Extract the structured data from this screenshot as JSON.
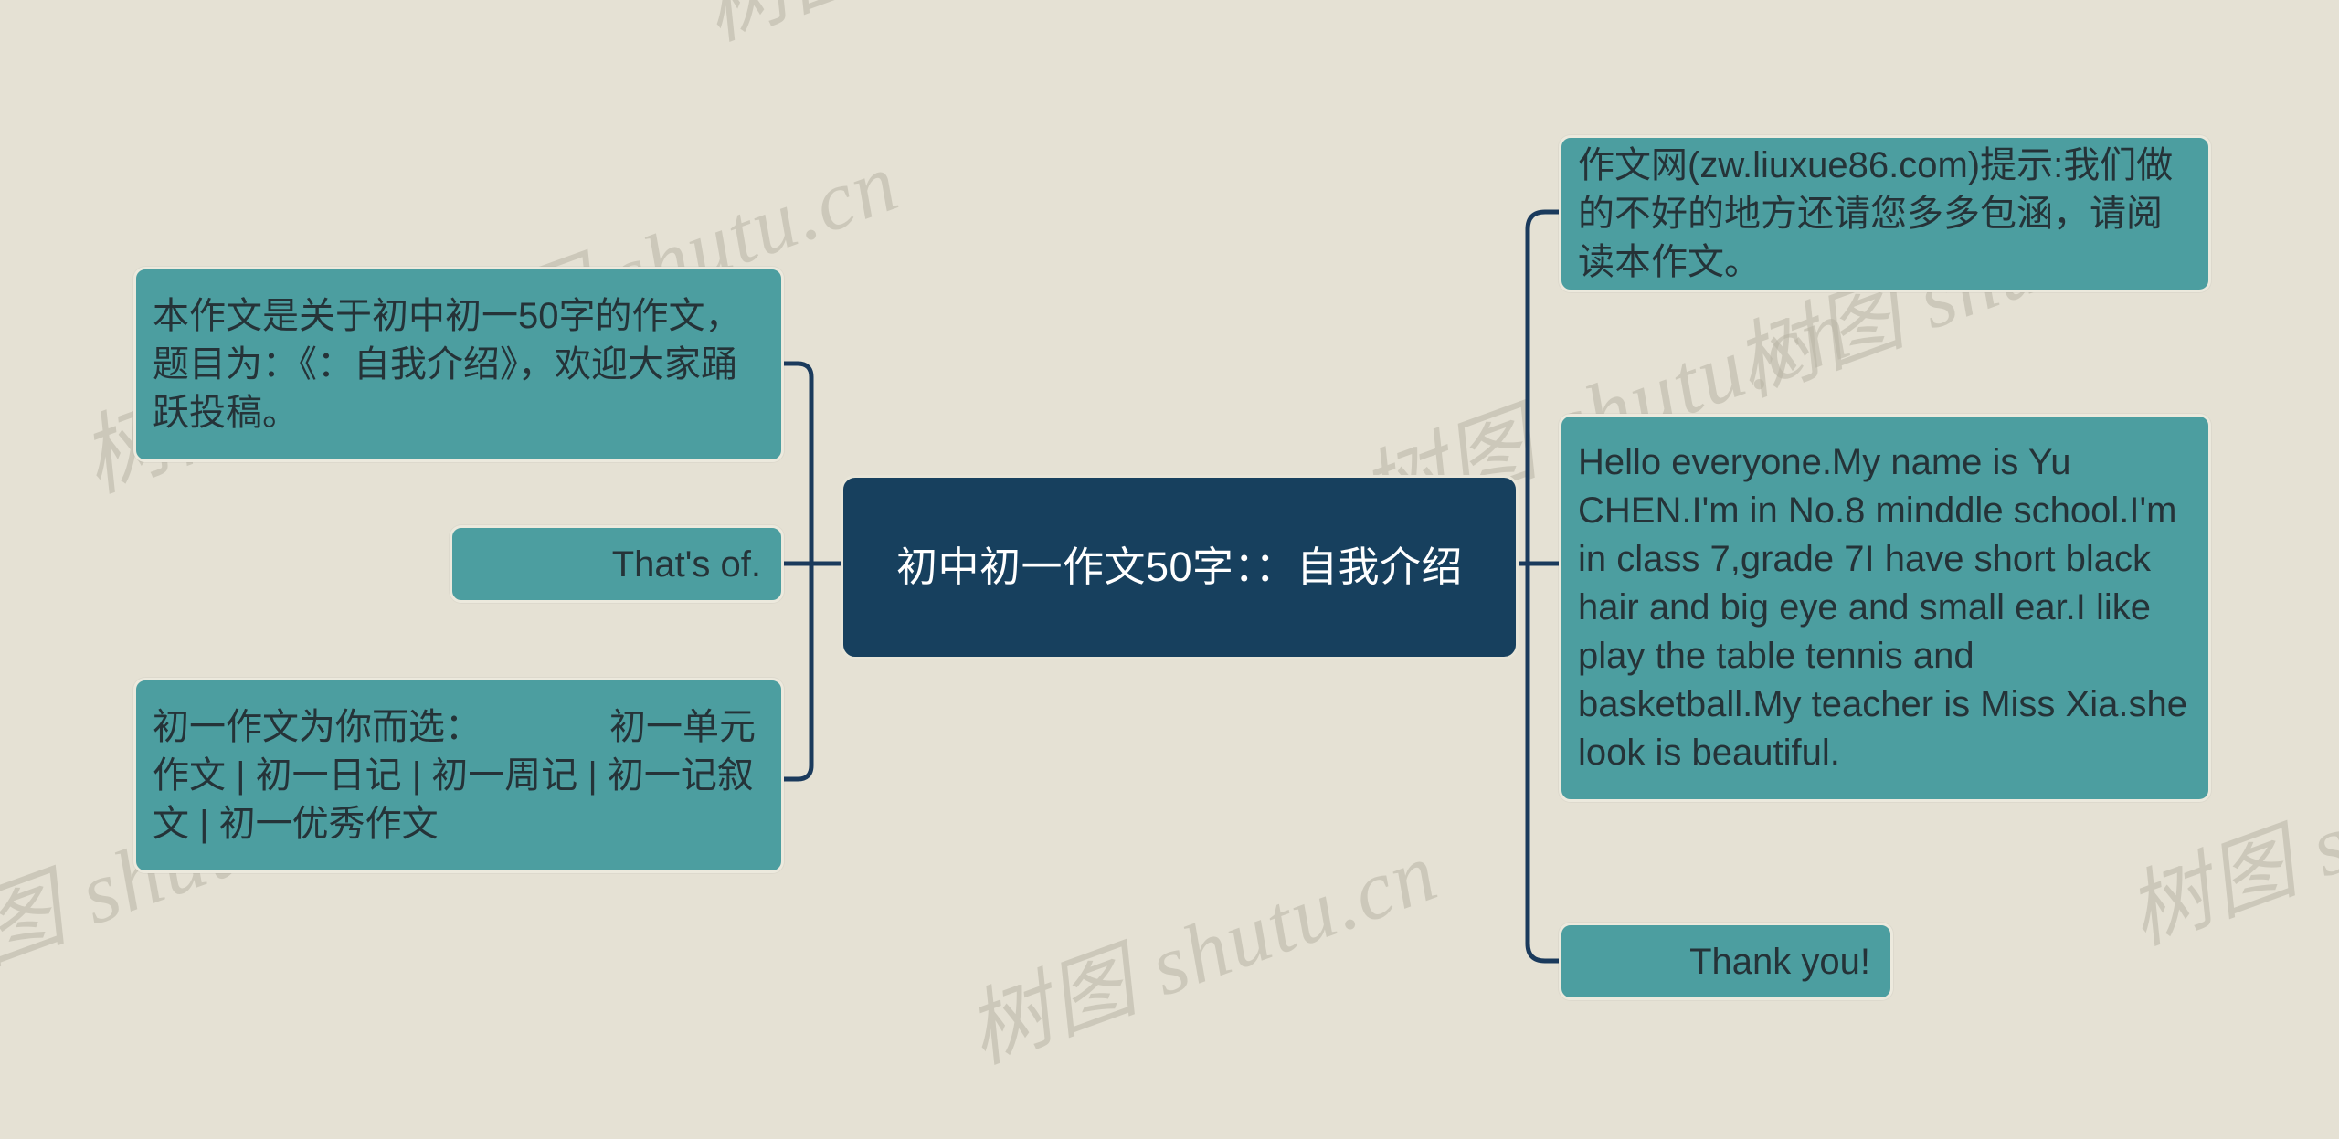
{
  "canvas": {
    "background_color": "#e5e1d4",
    "node_color": "#4c9ea0",
    "root_color": "#17405e",
    "connector_color": "#1a3a5c",
    "node_text_color": "#253338",
    "root_text_color": "#ffffff"
  },
  "watermark": {
    "text": "树图 shutu.cn",
    "color": "#b9b5a6"
  },
  "root": {
    "label": "初中初一作文50字：：自我介绍"
  },
  "branches": {
    "left": [
      {
        "id": "intro",
        "label": "本作文是关于初中初一50字的作文，题目为：《：自我介绍》，欢迎大家踊跃投稿。"
      },
      {
        "id": "thats",
        "label": "That's of."
      },
      {
        "id": "categories",
        "label": "初一作文为你而选：　　　　初一单元作文 | 初一日记 | 初一周记 | 初一记叙文 | 初一优秀作文"
      }
    ],
    "right": [
      {
        "id": "tip",
        "label": "作文网(zw.liuxue86.com)提示:我们做的不好的地方还请您多多包涵，请阅读本作文。"
      },
      {
        "id": "essay",
        "label": "Hello everyone.My name is Yu CHEN.I'm in  No.8 minddle school.I'm in class 7,grade 7I have short black hair and big eye and small ear.I like play the table tennis and basketball.My teacher is Miss Xia.she look is beautiful."
      },
      {
        "id": "thanks",
        "label": "Thank you!"
      }
    ]
  }
}
